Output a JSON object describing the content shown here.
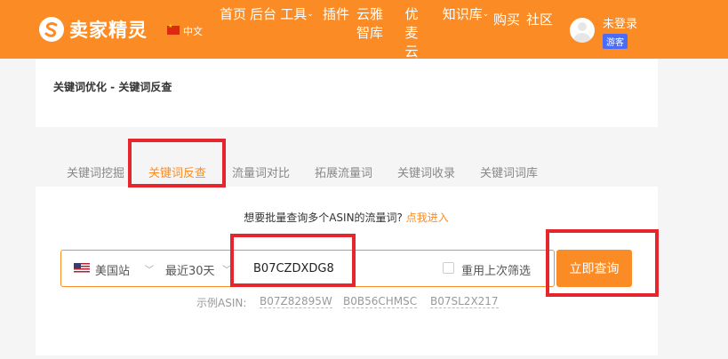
{
  "header": {
    "logo_text": "卖家精灵",
    "language": "中文",
    "nav": [
      {
        "label": "首页"
      },
      {
        "label": "后台"
      },
      {
        "label": "工具",
        "dropdown": true
      },
      {
        "label": "插件"
      },
      {
        "label": "云雅智库"
      },
      {
        "label": "优麦云"
      },
      {
        "label": "知识库",
        "dropdown": true
      },
      {
        "label": "购买"
      },
      {
        "label": "社区"
      }
    ],
    "login_text": "未登录",
    "guest_badge": "游客"
  },
  "breadcrumb": "关键词优化 - 关键词反查",
  "tabs": [
    {
      "label": "关键词挖掘",
      "active": false
    },
    {
      "label": "关键词反查",
      "active": true
    },
    {
      "label": "流量词对比",
      "active": false
    },
    {
      "label": "拓展流量词",
      "active": false
    },
    {
      "label": "关键词收录",
      "active": false
    },
    {
      "label": "关键词词库",
      "active": false
    }
  ],
  "hint": {
    "text": "想要批量查询多个ASIN的流量词?",
    "link": "点我进入"
  },
  "search": {
    "site": "美国站",
    "range": "最近30天",
    "asin_value": "B07CZDXDG8",
    "reuse_label": "重用上次筛选",
    "reuse_checked": false,
    "button_label": "立即查询"
  },
  "examples": {
    "label": "示例ASIN:",
    "items": [
      "B07Z82895W",
      "B0B56CHMSC",
      "B07SL2X217"
    ]
  },
  "colors": {
    "brand": "#fb8c25",
    "highlight": "#e5262d"
  }
}
